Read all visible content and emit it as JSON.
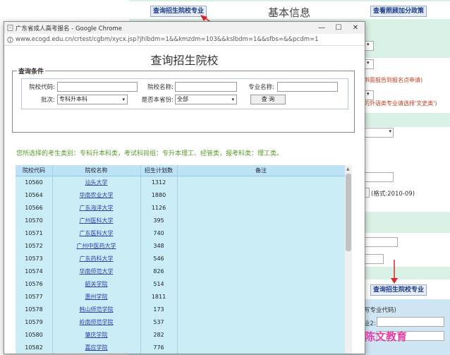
{
  "background": {
    "query_school_top": "查询招生院校专业",
    "page_title": "基本信息",
    "view_policy": "查看照顾加分政策",
    "red_note_1": "书面报告到报名点申请)",
    "red_note_2": "的外语类专业请选择'文史类')",
    "date_format": "(格式:2010-09)",
    "query_school_bottom": "查询招生院校专业",
    "major_code_note": "写专业代码)",
    "major2_label": "业2:"
  },
  "window": {
    "title": "广东省成人高考报名 - Google Chrome",
    "url": "www.ecogd.edu.cn/crtest/cgbm/xycx.jsp?jhlbdm=1&&kmzdm=103&&kslbdm=1&&sfbs=&&pcdm=1"
  },
  "query": {
    "heading": "查询招生院校",
    "legend": "查询条件",
    "school_code_label": "院校代码:",
    "school_name_label": "院校名称:",
    "major_name_label": "专业名称:",
    "batch_label": "批次:",
    "batch_value": "专科升本科",
    "local_label": "是否本省份:",
    "local_value": "全部",
    "submit": "查 询"
  },
  "notice": "您所选择的考生类别：专科升本科类，考试科目组：专升本理工、经管类，报考科类：理工类。",
  "table": {
    "headers": [
      "院校代码",
      "院校名称",
      "招生计划数",
      "备注"
    ],
    "rows": [
      [
        "10560",
        "汕头大学",
        "1312"
      ],
      [
        "10564",
        "华南农业大学",
        "1880"
      ],
      [
        "10566",
        "广东海洋大学",
        "1126"
      ],
      [
        "10570",
        "广州医科大学",
        "395"
      ],
      [
        "10571",
        "广东医科大学",
        "740"
      ],
      [
        "10572",
        "广州中医药大学",
        "348"
      ],
      [
        "10573",
        "广东药科大学",
        "546"
      ],
      [
        "10574",
        "华南师范大学",
        "826"
      ],
      [
        "10576",
        "韶关学院",
        "514"
      ],
      [
        "10577",
        "惠州学院",
        "1811"
      ],
      [
        "10578",
        "韩山师范学院",
        "173"
      ],
      [
        "10579",
        "岭南师范学院",
        "537"
      ],
      [
        "10580",
        "肇庆学院",
        "282"
      ],
      [
        "10582",
        "嘉应学院",
        "776"
      ]
    ]
  },
  "watermark": "陈文教育"
}
